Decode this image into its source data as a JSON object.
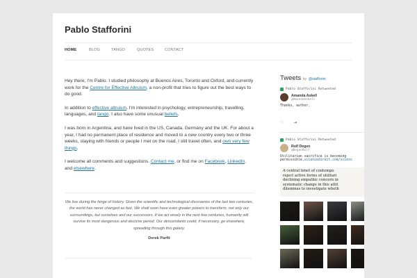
{
  "site": {
    "title": "Pablo Stafforini"
  },
  "nav": {
    "items": [
      "HOME",
      "BLOG",
      "TANGO",
      "QUOTES",
      "CONTACT"
    ]
  },
  "intro": {
    "p1": {
      "t1": "Hey there, I'm Pablo.  I studied philosophy at Buenos Aires, Toronto and Oxford, and currently work for the ",
      "link": "Centre for Effective Altruism",
      "t2": ", a non-profit that tries to figure out the best ways to do good."
    },
    "p2": {
      "t1": "In addition to ",
      "link1": "effective altruism",
      "t2": ", I'm interested in psychology, entrepreneurship, travelling, languages, and ",
      "link2": "tango",
      "t3": ". I also have some unusual ",
      "link3": "beliefs",
      "t4": "."
    },
    "p3": {
      "t1": "I was born in Argentina, and have lived in the US, Canada, Germany and the UK. For about a year, I had no permanent place of residence and moved to a new country every two or three weeks, staying with friends or people I met on the road. I still travel often, and ",
      "link": "own very few things",
      "t2": "."
    },
    "p4": {
      "t1": "I welcome all comments and suggestions.  ",
      "link1": "Contact me",
      "t2": ", or find me on ",
      "link2": "Facebook",
      "t3": ", ",
      "link3": "LinkedIn",
      "t4": ", and ",
      "link4": "elsewhere",
      "t5": "."
    }
  },
  "quote": {
    "text": "We live during the hinge of history. Given the scientific and technological discoveries of the last two centuries, the world has never changed as fast. We shall soon have even greater powers to transform, not only our surroundings, but ourselves and our successors. If we act wisely in the next few centuries, humanity will survive its most dangerous and decisive period. Our descendants could, if necessary, go elsewhere, spreading through this galaxy.",
    "author": "Derek Parfit"
  },
  "sidebar": {
    "title": "Tweets",
    "by": "by",
    "handle": "@stafforini",
    "tweets": [
      {
        "retweet_label": "Pablo Stafforini Retweeted",
        "name": "Amanda Askell",
        "handle": "@AmandaAskell",
        "text": "Thanks, author."
      },
      {
        "retweet_label": "Pablo Stafforini Retweeted",
        "name": "Rolf Degen",
        "handle": "@DegenRolf",
        "text": "Utilitarian sacrifice is becoming",
        "text2": "permissible.",
        "link": "sciencedirect.com/scienc"
      }
    ],
    "quote_image_lines": [
      "A central tenet of contempo",
      "reject active forms of utilitari",
      "declining empathic concern in",
      "systematic change in this attit",
      "dilemmas to investigate wheth"
    ],
    "thumb_colors": [
      "#1d1a17",
      "#6b5346",
      "#3b3a3f",
      "#8a8f86",
      "#46603a",
      "#2e2018",
      "#23201d",
      "#3d2b1f",
      "#6b6a58",
      "#241c16",
      "#524136",
      "#1b1713"
    ]
  }
}
